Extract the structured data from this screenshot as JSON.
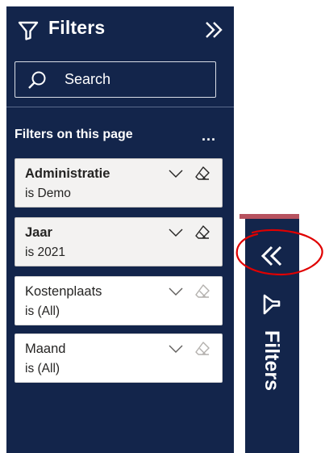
{
  "pane": {
    "title": "Filters",
    "search_placeholder": "Search",
    "section_title": "Filters on this page",
    "more_label": "...",
    "cards": [
      {
        "name": "Administratie",
        "value": "is Demo",
        "applied": true
      },
      {
        "name": "Jaar",
        "value": "is 2021",
        "applied": true
      },
      {
        "name": "Kostenplaats",
        "value": "is (All)",
        "applied": false
      },
      {
        "name": "Maand",
        "value": "is (All)",
        "applied": false
      }
    ]
  },
  "collapsed_tab": {
    "title": "Filters"
  },
  "colors": {
    "pane_background": "#13254b",
    "applied_card": "#f3f2f1",
    "tab_accent": "#b7525f",
    "annotation": "#e00000"
  },
  "icons": [
    "filter-icon",
    "collapse-chevrons-icon",
    "search-icon",
    "more-options-icon",
    "chevron-down-icon",
    "eraser-icon",
    "expand-chevrons-icon"
  ]
}
